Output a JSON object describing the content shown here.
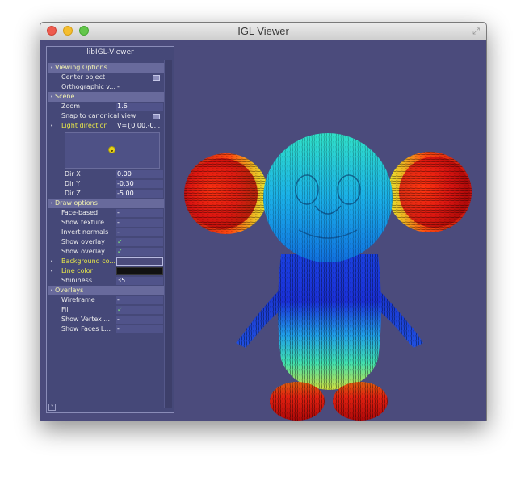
{
  "window": {
    "title": "IGL Viewer"
  },
  "panel": {
    "title": "libIGL-Viewer",
    "help": "?",
    "groups": {
      "viewing": {
        "label": "Viewing Options",
        "center_object": "Center object",
        "orthographic": "Orthographic v...",
        "orthographic_value": "-"
      },
      "scene": {
        "label": "Scene",
        "zoom": "Zoom",
        "zoom_value": "1.6",
        "snap": "Snap to canonical view",
        "light_direction": "Light direction",
        "light_direction_value": "V={0.00,-0...",
        "dir_x": "Dir X",
        "dir_x_value": "0.00",
        "dir_y": "Dir Y",
        "dir_y_value": "-0.30",
        "dir_z": "Dir Z",
        "dir_z_value": "-5.00"
      },
      "draw": {
        "label": "Draw options",
        "face_based": "Face-based",
        "face_based_value": "-",
        "show_texture": "Show texture",
        "show_texture_value": "-",
        "invert_normals": "Invert normals",
        "invert_normals_value": "-",
        "show_overlay": "Show overlay",
        "show_overlay_value": "✓",
        "show_overlay_depth": "Show overlay...",
        "show_overlay_depth_value": "✓",
        "background_color": "Background co...",
        "line_color": "Line color",
        "shininess": "Shininess",
        "shininess_value": "35"
      },
      "overlays": {
        "label": "Overlays",
        "wireframe": "Wireframe",
        "wireframe_value": "-",
        "fill": "Fill",
        "fill_value": "✓",
        "show_vertex": "Show Vertex ...",
        "show_vertex_value": "-",
        "show_faces": "Show Faces L...",
        "show_faces_value": "-"
      }
    }
  },
  "colors": {
    "background": "#4b4b7c",
    "line_color": "#111111",
    "highlight_label": "#e8e84a"
  }
}
